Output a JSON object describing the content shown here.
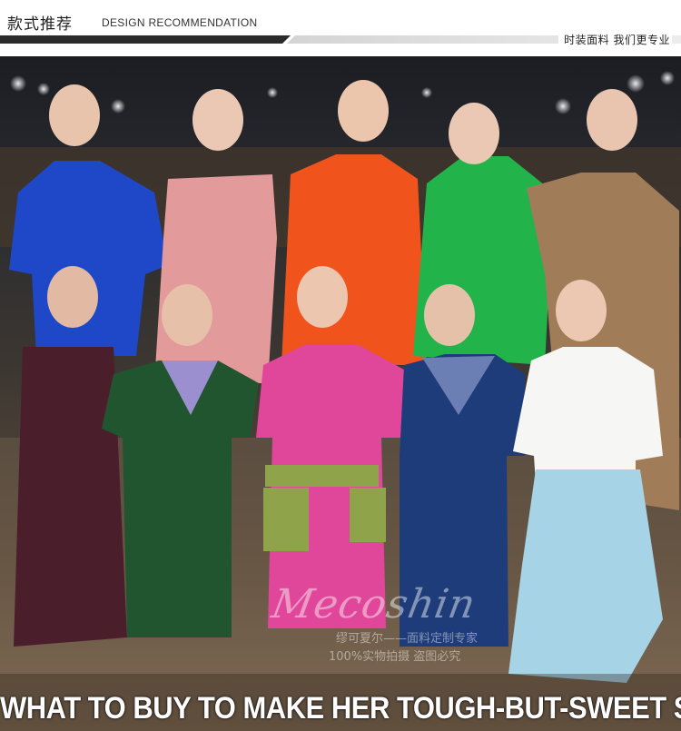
{
  "header": {
    "title_cn": "款式推荐",
    "title_en": "DESIGN RECOMMENDATION",
    "tagline": "时装面料 我们更专业"
  },
  "photo": {
    "watermark_brand": "Mecoshin",
    "watermark_line1": "缪可夏尔——面料定制专家",
    "watermark_line2": "100%实物拍摄 盗图必究",
    "slogan": "WHAT TO BUY TO MAKE HER TOUGH-BUT-SWEET SYTLE YOUR OWN"
  },
  "colors": {
    "back_row": [
      "#1f48c8",
      "#e39a9a",
      "#f0541c",
      "#22b34a",
      "#a07c58"
    ],
    "front_row": [
      "#4b1e2b",
      "#21552f",
      "#e0479a",
      "#1e3c7a",
      "#ffffff"
    ],
    "skirt": "#a7d3e6",
    "belt": "#8ea34a"
  }
}
